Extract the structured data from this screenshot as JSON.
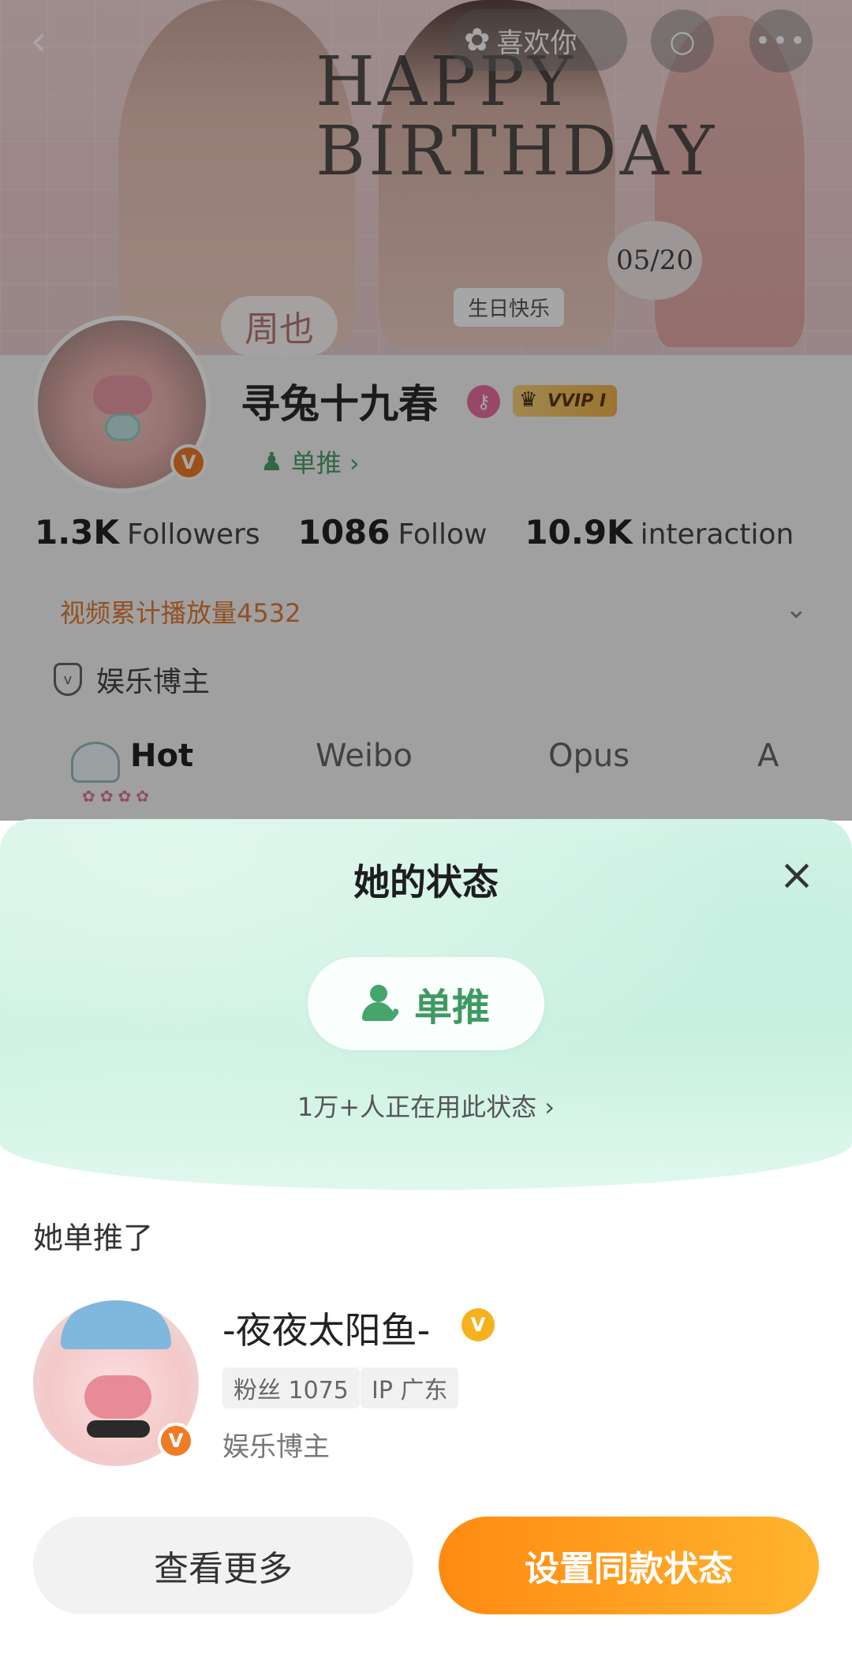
{
  "banner": {
    "headline": "HAPPY\nBIRTHDAY",
    "birthday_tag": "生日快乐",
    "name_tag": "周也",
    "date_tag": "05/20"
  },
  "nav": {
    "like_label": "喜欢你"
  },
  "profile": {
    "name": "寻兔十九春",
    "vip_label": "VVIP I",
    "status_link": "单推 ›",
    "stats": [
      {
        "value": "1.3K",
        "label": "Followers"
      },
      {
        "value": "1086",
        "label": "Follow"
      },
      {
        "value": "10.9K",
        "label": "interaction"
      }
    ],
    "video_plays": "视频累计播放量4532",
    "role": "娱乐博主"
  },
  "tabs": [
    {
      "label": "Hot"
    },
    {
      "label": "Weibo"
    },
    {
      "label": "Opus"
    },
    {
      "label": "A"
    }
  ],
  "sheet": {
    "title": "她的状态",
    "status_label": "单推",
    "users_count": "1万+人正在用此状态 ›",
    "section_label": "她单推了",
    "target": {
      "name": "-夜夜太阳鱼-",
      "fans_chip": "粉丝 1075",
      "ip_chip": "IP 广东",
      "role": "娱乐博主"
    },
    "buttons": {
      "more": "查看更多",
      "set_same": "设置同款状态"
    }
  },
  "colors": {
    "accent_green": "#3e9a61",
    "accent_orange": "#ff8a12",
    "verified_orange": "#f07b25",
    "verified_gold": "#f5b21e"
  }
}
